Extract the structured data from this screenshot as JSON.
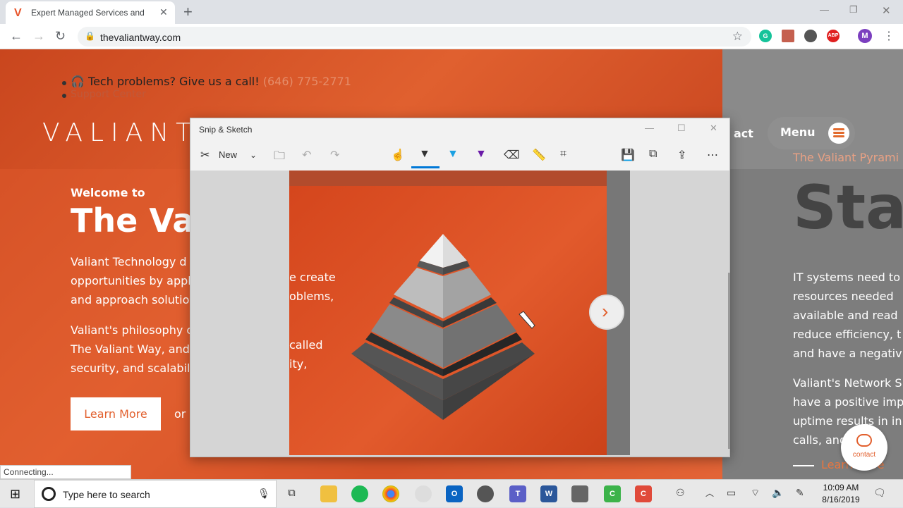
{
  "browser": {
    "tab_title": "Expert Managed Services and IT C",
    "tab_favicon": "V",
    "url": "thevaliantway.com",
    "profile_initial": "M",
    "extensions": [
      {
        "name": "grammarly-icon",
        "color": "#15c39a",
        "label": "G"
      },
      {
        "name": "pdf-icon",
        "color": "#c5604f",
        "label": ""
      },
      {
        "name": "circle-extension-icon",
        "color": "#555555",
        "label": ""
      },
      {
        "name": "adblock-icon",
        "color": "#e02020",
        "label": "ABP"
      }
    ]
  },
  "page": {
    "top_line": "Tech problems? Give us a call!",
    "phone": "(646) 775-2771",
    "support": "Support Center",
    "logo": "VALIANT",
    "welcome": "Welcome to",
    "big_title": "The Val",
    "para1": [
      "Valiant Technology d",
      "opportunities by appl",
      "and approach solutio"
    ],
    "para2": [
      "Valiant's philosophy c",
      "The Valiant Way, and",
      "security, and scalabili"
    ],
    "learn_more": "Learn More",
    "or_text": "or s",
    "contact_nav": "act",
    "menu_label": "Menu",
    "pyramid_link": "The Valiant Pyrami",
    "sta": "Sta",
    "rpara1": [
      "IT systems need to",
      "resources needed",
      "available and read",
      "reduce efficiency, t",
      "and have a negativ"
    ],
    "rpara2": [
      "Valiant's Network S",
      "have a positive imp",
      "uptime results in in",
      "calls, and"
    ],
    "learn_right": "Learn More",
    "contact_fab": "contact",
    "status": "Connecting..."
  },
  "snip": {
    "title": "Snip & Sketch",
    "new_label": "New",
    "snip_text": [
      "e create",
      "oblems,",
      "called",
      "ity,"
    ]
  },
  "taskbar": {
    "search_placeholder": "Type here to search",
    "time": "10:09 AM",
    "date": "8/16/2019"
  }
}
